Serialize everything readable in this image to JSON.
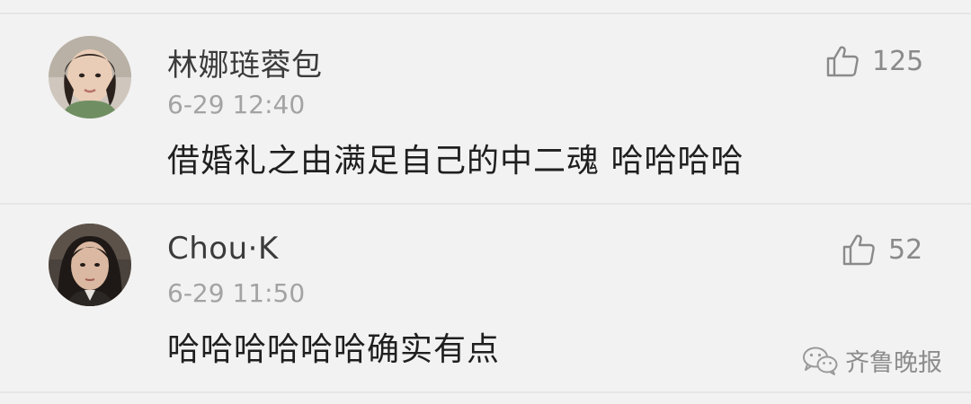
{
  "comments": [
    {
      "username": "林娜琏蓉包",
      "time": "6-29 12:40",
      "text": "借婚礼之由满足自己的中二魂 哈哈哈哈",
      "likes": "125",
      "avatar_icon": "user-avatar-photo",
      "like_icon": "thumbs-up-icon"
    },
    {
      "username": "Chou·K",
      "time": "6-29 11:50",
      "text": "哈哈哈哈哈哈确实有点",
      "likes": "52",
      "avatar_icon": "user-avatar-photo",
      "like_icon": "thumbs-up-icon"
    }
  ],
  "watermark": {
    "text": "齐鲁晚报",
    "icon": "wechat-icon"
  },
  "colors": {
    "background": "#f2f2f2",
    "username": "#3b3b3b",
    "timestamp": "#a3a3a3",
    "body": "#1f1f1f",
    "like": "#8a8a8a"
  }
}
